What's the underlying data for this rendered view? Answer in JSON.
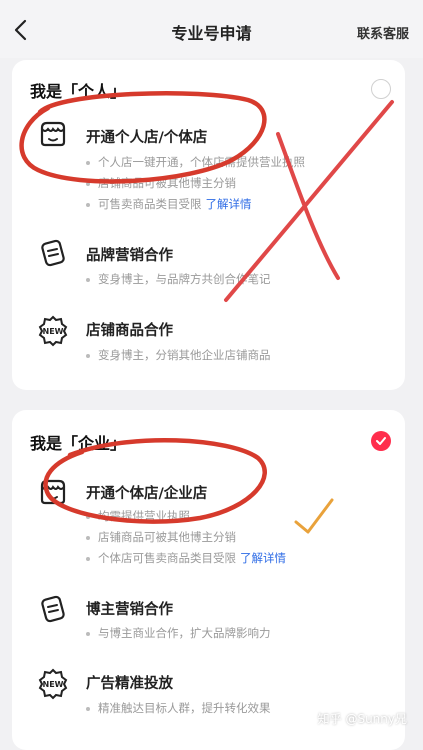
{
  "nav": {
    "title": "专业号申请",
    "contact_label": "联系客服"
  },
  "cards": [
    {
      "title": "我是「个人」",
      "selected": false,
      "options": [
        {
          "icon": "store-icon",
          "title": "开通个人店/个体店",
          "bullets": [
            "个人店一键开通，个体店需提供营业执照",
            "店铺商品可被其他博主分销",
            "可售卖商品类目受限"
          ],
          "link": "了解详情"
        },
        {
          "icon": "note-card-icon",
          "title": "品牌营销合作",
          "bullets": [
            "变身博主，与品牌方共创合作笔记"
          ]
        },
        {
          "icon": "new-badge-icon",
          "title": "店铺商品合作",
          "bullets": [
            "变身博主，分销其他企业店铺商品"
          ]
        }
      ]
    },
    {
      "title": "我是「企业」",
      "selected": true,
      "options": [
        {
          "icon": "store-icon",
          "title": "开通个体店/企业店",
          "bullets": [
            "均需提供营业执照",
            "店铺商品可被其他博主分销",
            "个体店可售卖商品类目受限"
          ],
          "link": "了解详情"
        },
        {
          "icon": "note-card-icon",
          "title": "博主营销合作",
          "bullets": [
            "与博主商业合作，扩大品牌影响力"
          ]
        },
        {
          "icon": "new-badge-icon",
          "title": "广告精准投放",
          "bullets": [
            "精准触达目标人群，提升转化效果"
          ]
        }
      ]
    }
  ],
  "watermark": "知乎 @Sunny兄",
  "colors": {
    "accent": "#ff2e4d",
    "link": "#2d6be6",
    "annotation": "#d63a2c",
    "checkmark": "#e9a23b"
  }
}
